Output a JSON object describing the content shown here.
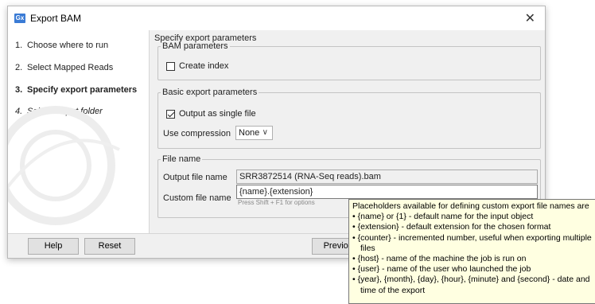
{
  "window": {
    "title": "Export BAM",
    "app_icon_text": "Gx"
  },
  "steps": [
    {
      "num": "1.",
      "label": "Choose where to run"
    },
    {
      "num": "2.",
      "label": "Select Mapped Reads"
    },
    {
      "num": "3.",
      "label": "Specify export parameters"
    },
    {
      "num": "4.",
      "label": "Select output folder"
    }
  ],
  "main": {
    "section_title": "Specify export parameters",
    "bam_group": {
      "legend": "BAM parameters",
      "create_index_label": "Create index",
      "create_index_checked": false
    },
    "basic_group": {
      "legend": "Basic export parameters",
      "single_file_label": "Output as single file",
      "single_file_checked": true,
      "compression_label": "Use compression",
      "compression_value": "None"
    },
    "file_group": {
      "legend": "File name",
      "output_label": "Output file name",
      "output_value": "SRR3872514 (RNA-Seq reads).bam",
      "custom_label": "Custom file name",
      "custom_value": "{name}.{extension}",
      "custom_hint": "Press Shift + F1 for options"
    }
  },
  "footer": {
    "help": "Help",
    "reset": "Reset",
    "previous": "Previous"
  },
  "tooltip": {
    "title": "Placeholders available for defining custom export file names are",
    "items": [
      "• {name} or {1} - default name for the input object",
      "• {extension} - default extension for the chosen format",
      "• {counter} - incremented number, useful when exporting multiple files",
      "• {host} - name of the machine the job is run on",
      "• {user} - name of the user who launched the job",
      "• {year}, {month}, {day}, {hour}, {minute} and {second} - date and time of the export"
    ]
  }
}
